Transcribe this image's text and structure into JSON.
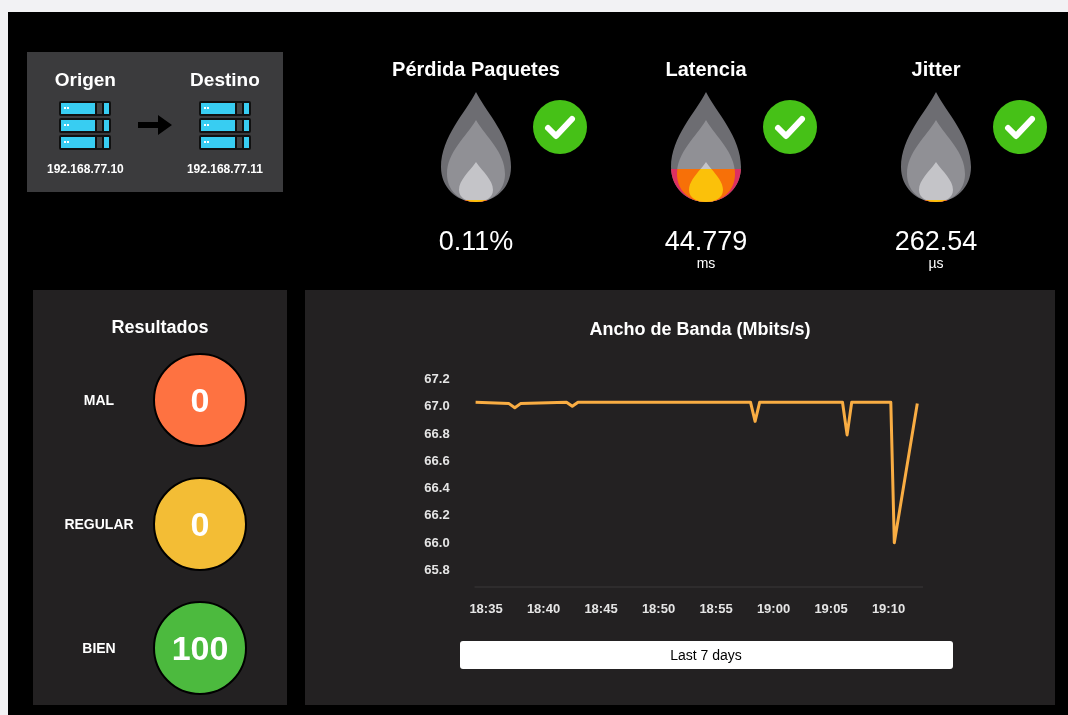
{
  "route": {
    "source": {
      "title": "Origen",
      "ip": "192.168.77.10"
    },
    "destination": {
      "title": "Destino",
      "ip": "192.168.77.11"
    }
  },
  "gauges": [
    {
      "title": "Pérdida Paquetes",
      "kind": "cool",
      "ok": true,
      "value": "0.11%"
    },
    {
      "title": "Latencia",
      "kind": "warm",
      "ok": true,
      "value": "44.779",
      "unit": "ms"
    },
    {
      "title": "Jitter",
      "kind": "cool",
      "ok": true,
      "value": "262.54",
      "unit": "µs"
    }
  ],
  "results": {
    "title": "Resultados",
    "items": [
      {
        "label": "MAL",
        "count": "0",
        "color": "#fe7241"
      },
      {
        "label": "REGULAR",
        "count": "0",
        "color": "#f3bd35"
      },
      {
        "label": "BIEN",
        "count": "100",
        "color": "#4cba3e"
      }
    ]
  },
  "bandwidth": {
    "chart_data": {
      "type": "line",
      "title": "Ancho de Banda (Mbits/s)",
      "x": [
        1114.1,
        1117,
        1117.5,
        1118,
        1122,
        1122.5,
        1123,
        1138,
        1138.4,
        1138.8,
        1146,
        1146.4,
        1146.8,
        1150.2,
        1150.5,
        1152.5
      ],
      "series": [
        {
          "color": "#f9ad43",
          "values": [
            67.03,
            67.02,
            66.99,
            67.02,
            67.03,
            67.0,
            67.03,
            67.03,
            66.89,
            67.03,
            67.03,
            66.79,
            67.03,
            67.03,
            66.0,
            67.02
          ]
        }
      ],
      "xlim": [
        1114,
        1153
      ],
      "ylim": [
        65.8,
        67.2
      ],
      "xticks": [
        {
          "value": 1115,
          "label": "18:35"
        },
        {
          "value": 1120,
          "label": "18:40"
        },
        {
          "value": 1125,
          "label": "18:45"
        },
        {
          "value": 1130,
          "label": "18:50"
        },
        {
          "value": 1135,
          "label": "18:55"
        },
        {
          "value": 1140,
          "label": "19:00"
        },
        {
          "value": 1145,
          "label": "19:05"
        },
        {
          "value": 1150,
          "label": "19:10"
        }
      ],
      "yticks": [
        {
          "value": 67.2,
          "label": "67.2"
        },
        {
          "value": 67.0,
          "label": "67.0"
        },
        {
          "value": 66.8,
          "label": "66.8"
        },
        {
          "value": 66.6,
          "label": "66.6"
        },
        {
          "value": 66.4,
          "label": "66.4"
        },
        {
          "value": 66.2,
          "label": "66.2"
        },
        {
          "value": 66.0,
          "label": "66.0"
        },
        {
          "value": 65.8,
          "label": "65.8"
        }
      ]
    },
    "range_button": "Last 7 days"
  }
}
